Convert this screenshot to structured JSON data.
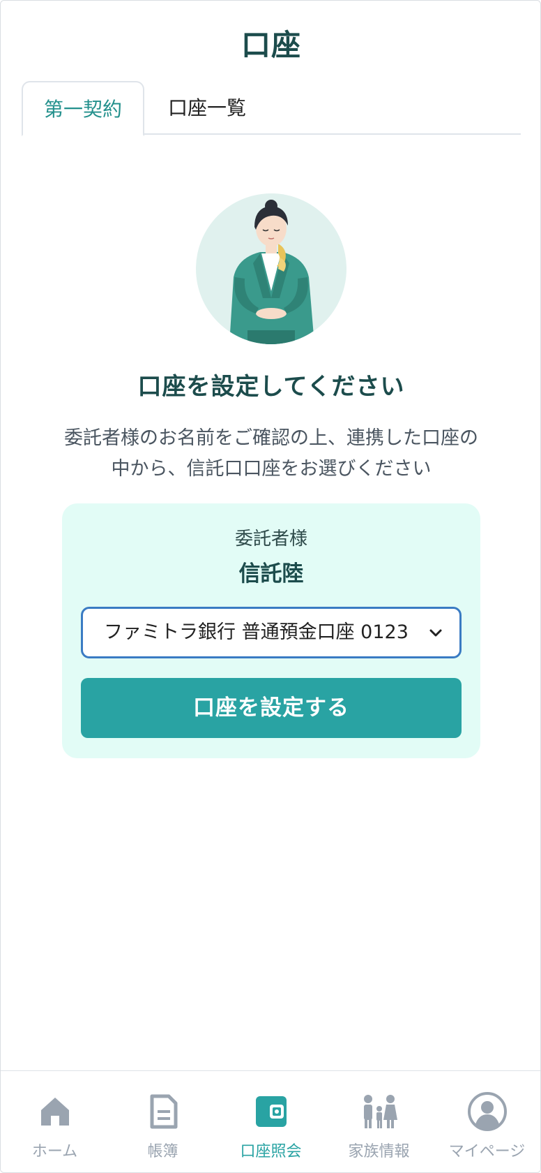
{
  "header": {
    "title": "口座"
  },
  "tabs": [
    {
      "label": "第一契約",
      "active": true
    },
    {
      "label": "口座一覧",
      "active": false
    }
  ],
  "main": {
    "heading": "口座を設定してください",
    "description": "委託者様のお名前をご確認の上、連携した口座の中から、信託口口座をお選びください",
    "card": {
      "consignor_label": "委託者様",
      "consignor_name": "信託陸",
      "account_select": {
        "selected": "ファミトラ銀行 普通預金口座 0123"
      },
      "submit_label": "口座を設定する"
    }
  },
  "bottom_nav": [
    {
      "label": "ホーム",
      "icon": "home-icon",
      "active": false
    },
    {
      "label": "帳簿",
      "icon": "document-icon",
      "active": false
    },
    {
      "label": "口座照会",
      "icon": "wallet-icon",
      "active": true
    },
    {
      "label": "家族情報",
      "icon": "family-icon",
      "active": false
    },
    {
      "label": "マイページ",
      "icon": "user-icon",
      "active": false
    }
  ],
  "colors": {
    "accent": "#29a3a3",
    "heading": "#1c4c4c",
    "card_bg": "#e2fcf6",
    "select_border": "#3a7bc3",
    "nav_inactive": "#9aa4b0"
  }
}
